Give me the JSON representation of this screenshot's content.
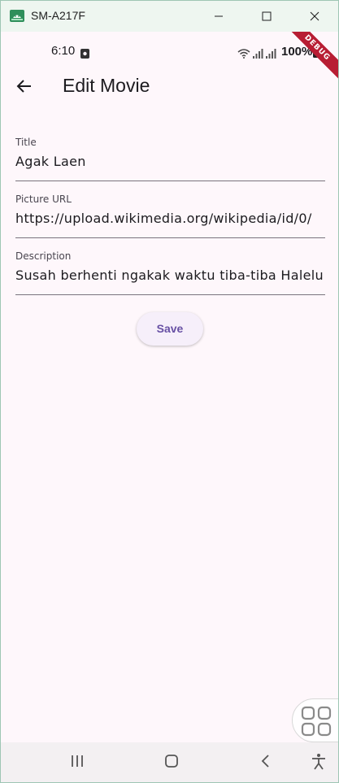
{
  "window": {
    "title": "SM-A217F",
    "min_icon": "minimize-icon",
    "max_icon": "maximize-icon",
    "close_icon": "close-icon"
  },
  "status_bar": {
    "time": "6:10",
    "battery": "100%"
  },
  "debug_banner": "DEBUG",
  "app_bar": {
    "title": "Edit Movie",
    "back_icon": "arrow-back-icon"
  },
  "form": {
    "title": {
      "label": "Title",
      "value": "Agak Laen"
    },
    "picture_url": {
      "label": "Picture URL",
      "value": "https://upload.wikimedia.org/wikipedia/id/0/"
    },
    "description": {
      "label": "Description",
      "value": "Susah berhenti ngakak waktu tiba-tiba Halelu"
    },
    "save_label": "Save"
  },
  "colors": {
    "primary": "#6750a4",
    "background": "#fef7fb",
    "debug_ribbon": "#b81d33"
  }
}
